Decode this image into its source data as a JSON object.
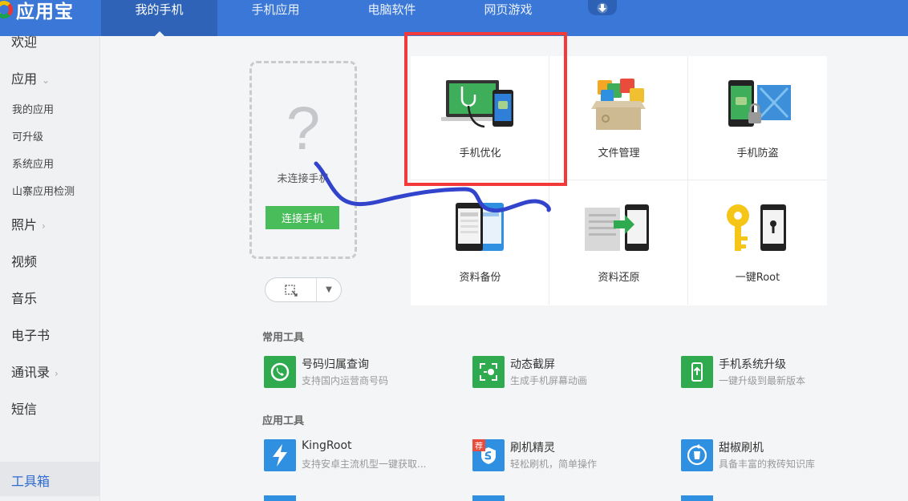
{
  "header": {
    "logo_text": "应用宝",
    "tabs": [
      {
        "label": "我的手机"
      },
      {
        "label": "手机应用"
      },
      {
        "label": "电脑软件"
      },
      {
        "label": "网页游戏"
      }
    ]
  },
  "sidebar": {
    "items": [
      {
        "label": "欢迎"
      },
      {
        "label": "应用"
      },
      {
        "label": "我的应用"
      },
      {
        "label": "可升级"
      },
      {
        "label": "系统应用"
      },
      {
        "label": "山寨应用检测"
      },
      {
        "label": "照片"
      },
      {
        "label": "视频"
      },
      {
        "label": "音乐"
      },
      {
        "label": "电子书"
      },
      {
        "label": "通讯录"
      },
      {
        "label": "短信"
      },
      {
        "label": "工具箱"
      }
    ]
  },
  "device": {
    "question_mark": "?",
    "status": "未连接手机",
    "connect_label": "连接手机"
  },
  "functions": [
    {
      "label": "手机优化"
    },
    {
      "label": "文件管理"
    },
    {
      "label": "手机防盗"
    },
    {
      "label": "资料备份"
    },
    {
      "label": "资料还原"
    },
    {
      "label": "一键Root"
    }
  ],
  "common_tools": {
    "title": "常用工具",
    "items": [
      {
        "name": "号码归属查询",
        "desc": "支持国内运营商号码"
      },
      {
        "name": "动态截屏",
        "desc": "生成手机屏幕动画"
      },
      {
        "name": "手机系统升级",
        "desc": "一键升级到最新版本"
      }
    ]
  },
  "app_tools": {
    "title": "应用工具",
    "items": [
      {
        "name": "KingRoot",
        "desc": "支持安卓主流机型一键获取..."
      },
      {
        "name": "刷机精灵",
        "desc": "轻松刷机，简单操作"
      },
      {
        "name": "甜椒刷机",
        "desc": "具备丰富的救砖知识库"
      }
    ],
    "badge": "荐"
  },
  "colors": {
    "header_blue": "#3a77d6",
    "accent_green": "#49bd5a",
    "highlight_red": "#f23a3a",
    "scribble_blue": "#3344cc"
  }
}
